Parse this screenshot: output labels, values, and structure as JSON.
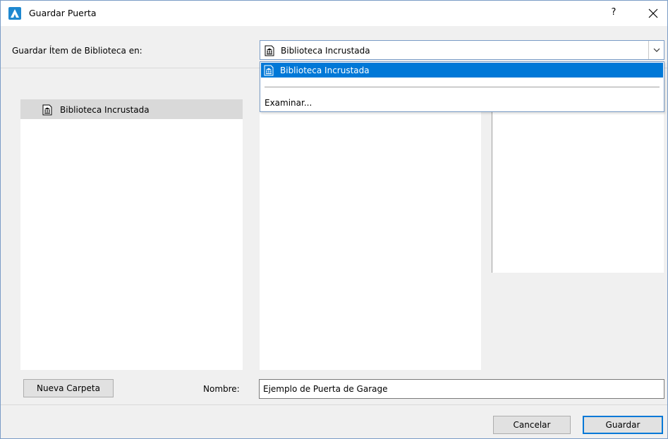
{
  "window": {
    "title": "Guardar Puerta",
    "help_label": "?",
    "close_label": "✕",
    "icon": "archicad-app-icon"
  },
  "save_location": {
    "label": "Guardar Ítem de Biblioteca en:",
    "selected": "Biblioteca Incrustada",
    "dropdown_open": true,
    "options": [
      {
        "label": "Biblioteca Incrustada",
        "icon": "library-icon",
        "selected": true
      },
      {
        "label": "Examinar...",
        "icon": "",
        "selected": false
      }
    ]
  },
  "library_tree": {
    "items": [
      {
        "label": "Biblioteca Incrustada",
        "icon": "library-icon",
        "selected": true
      }
    ]
  },
  "footer": {
    "new_folder_label": "Nueva Carpeta",
    "name_label": "Nombre:",
    "name_value": "Ejemplo de Puerta de Garage",
    "cancel_label": "Cancelar",
    "save_label": "Guardar"
  },
  "colors": {
    "accent": "#0078d7",
    "border": "#7a9cc6",
    "selection_gray": "#d9d9d9"
  }
}
